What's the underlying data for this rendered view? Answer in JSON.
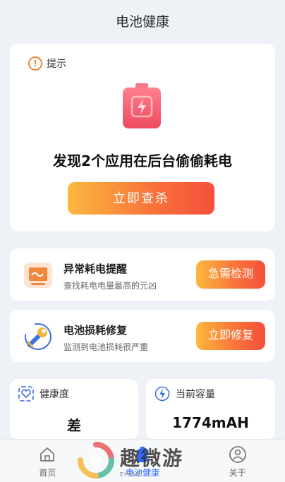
{
  "header": {
    "title": "电池健康"
  },
  "tip": {
    "label": "提示",
    "message": "发现2个应用在后台偷偷耗电",
    "button": "立即查杀"
  },
  "rows": [
    {
      "title": "异常耗电提醒",
      "subtitle": "查找耗电电量最高的元凶",
      "button": "急需检测",
      "icon": "monitor-icon"
    },
    {
      "title": "电池损耗修复",
      "subtitle": "监测到电池损耗很严重",
      "button": "立即修复",
      "icon": "wrench-icon"
    }
  ],
  "stats": [
    {
      "label": "健康度",
      "value": "差",
      "icon": "heart-check-icon"
    },
    {
      "label": "当前容量",
      "value": "1774mAH",
      "icon": "bolt-icon"
    }
  ],
  "tabs": [
    {
      "label": "首页",
      "icon": "home-icon"
    },
    {
      "label": "电池健康",
      "icon": "battery-icon",
      "active": true
    },
    {
      "label": "关于",
      "icon": "user-icon"
    }
  ],
  "watermark": {
    "text": "趣微游",
    "sub": "EIYOU"
  },
  "colors": {
    "accent": "#2f6bff",
    "button_start": "#fbb83e",
    "button_end": "#f5503c",
    "battery": "#f2506a"
  }
}
